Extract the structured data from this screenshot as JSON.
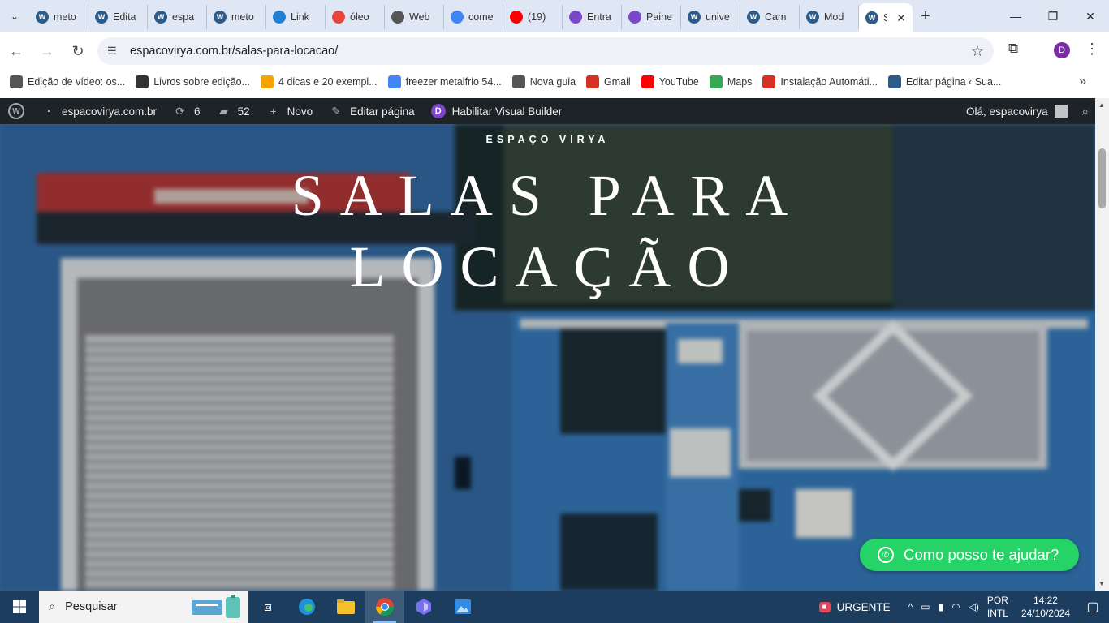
{
  "browser": {
    "tabs": [
      {
        "label": "meto",
        "icon": "wordpress-icon",
        "color": "#2c5b8a"
      },
      {
        "label": "Edita",
        "icon": "wordpress-icon",
        "color": "#2c5b8a"
      },
      {
        "label": "espa",
        "icon": "wordpress-icon",
        "color": "#2c5b8a"
      },
      {
        "label": "meto",
        "icon": "wordpress-icon",
        "color": "#2c5b8a"
      },
      {
        "label": "Link",
        "icon": "link-icon",
        "color": "#1f7fd4"
      },
      {
        "label": "óleo",
        "icon": "drive-icon",
        "color": "#e8453c"
      },
      {
        "label": "Web",
        "icon": "globe-icon",
        "color": "#555555"
      },
      {
        "label": "come",
        "icon": "google-icon",
        "color": "#4285f4"
      },
      {
        "label": "(19)",
        "icon": "youtube-icon",
        "color": "#ff0000"
      },
      {
        "label": "Entra",
        "icon": "app-icon",
        "color": "#7b46c8"
      },
      {
        "label": "Paine",
        "icon": "app-icon",
        "color": "#7b46c8"
      },
      {
        "label": "unive",
        "icon": "wordpress-icon",
        "color": "#2c5b8a"
      },
      {
        "label": "Cam",
        "icon": "wordpress-icon",
        "color": "#2c5b8a"
      },
      {
        "label": "Mod",
        "icon": "wordpress-icon",
        "color": "#2c5b8a"
      }
    ],
    "active_tab": {
      "label": "S",
      "icon": "wordpress-icon"
    },
    "address": "espacovirya.com.br/salas-para-locacao/",
    "profile_initial": "D",
    "bookmarks": [
      {
        "label": "Edição de vídeo: os...",
        "icon": "globe-icon",
        "color": "#555555"
      },
      {
        "label": "Livros sobre edição...",
        "icon": "camera-icon",
        "color": "#333333"
      },
      {
        "label": "4 dicas e 20 exempl...",
        "icon": "heart-icon",
        "color": "#f4a300"
      },
      {
        "label": "freezer metalfrio 54...",
        "icon": "google-icon",
        "color": "#4285f4"
      },
      {
        "label": "Nova guia",
        "icon": "globe-icon",
        "color": "#555555"
      },
      {
        "label": "Gmail",
        "icon": "gmail-icon",
        "color": "#d93025"
      },
      {
        "label": "YouTube",
        "icon": "youtube-icon",
        "color": "#ff0000"
      },
      {
        "label": "Maps",
        "icon": "maps-icon",
        "color": "#34a853"
      },
      {
        "label": "Instalação Automáti...",
        "icon": "gmail-icon",
        "color": "#d93025"
      },
      {
        "label": "Editar página ‹ Sua...",
        "icon": "wordpress-icon",
        "color": "#2c5b8a"
      }
    ]
  },
  "adminbar": {
    "site": "espacovirya.com.br",
    "updates": "6",
    "comments": "52",
    "new": "Novo",
    "edit": "Editar página",
    "visual_builder": "Habilitar Visual Builder",
    "greeting": "Olá, espacovirya"
  },
  "hero": {
    "subtitle": "ESPAÇO VIRYA",
    "title_line1": "SALAS PARA",
    "title_line2": "LOCAÇÃO"
  },
  "whatsapp": {
    "label": "Como posso te ajudar?",
    "color": "#25d366"
  },
  "taskbar": {
    "search_placeholder": "Pesquisar",
    "alert_label": "URGENTE",
    "lang_1": "POR",
    "lang_2": "INTL",
    "time": "14:22",
    "date": "24/10/2024"
  }
}
